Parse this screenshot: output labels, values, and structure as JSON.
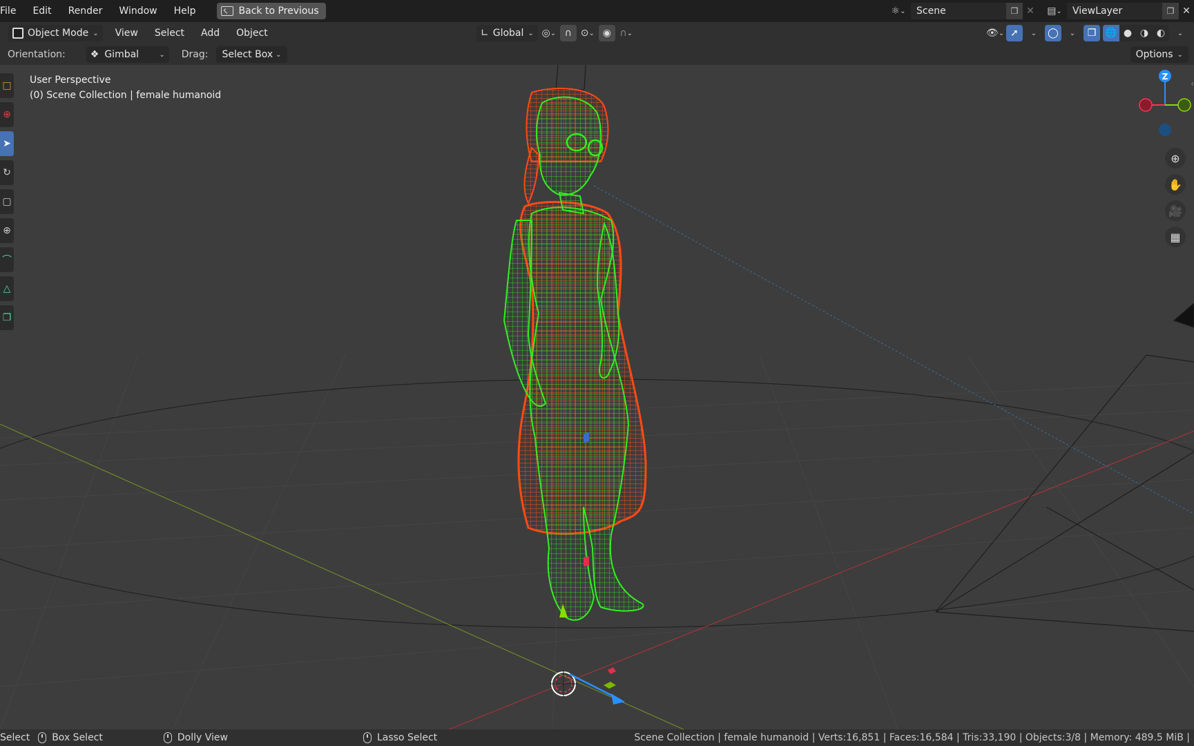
{
  "menubar": {
    "items": [
      "File",
      "Edit",
      "Render",
      "Window",
      "Help"
    ],
    "back_button": "Back to Previous",
    "scene_name": "Scene",
    "view_layer": "ViewLayer"
  },
  "header": {
    "mode": "Object Mode",
    "menus": [
      "View",
      "Select",
      "Add",
      "Object"
    ],
    "transform_orientation": "Global"
  },
  "tool_settings": {
    "orientation_label": "Orientation:",
    "orientation_value": "Gimbal",
    "drag_label": "Drag:",
    "drag_value": "Select Box",
    "options_label": "Options"
  },
  "viewport": {
    "perspective": "User Perspective",
    "collection": "(0) Scene Collection | female humanoid",
    "gizmo_axis_label": "Z"
  },
  "statusbar": {
    "select": "Select",
    "box_select": "Box Select",
    "dolly_view": "Dolly View",
    "lasso_select": "Lasso Select",
    "stats": "Scene Collection | female humanoid | Verts:16,851 | Faces:16,584 | Tris:33,190 | Objects:3/8 | Memory: 489.5 MiB |"
  },
  "colors": {
    "accent": "#4772b3",
    "wire_green": "#33ee22",
    "wire_orange": "#ff4a14",
    "axis_x": "#ff3352",
    "axis_y": "#8bdc00",
    "axis_z": "#2890ff"
  }
}
